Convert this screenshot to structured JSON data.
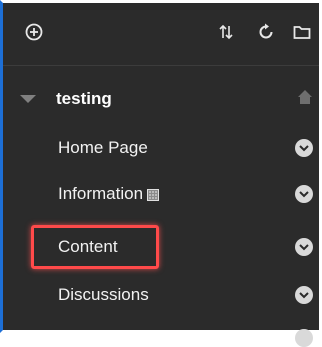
{
  "toolbar": {
    "icons": [
      "add-icon",
      "reorder-icon",
      "refresh-icon",
      "folder-icon"
    ]
  },
  "course": {
    "title": "testing",
    "home_icon": "home-icon"
  },
  "menu": {
    "items": [
      {
        "label": "Home Page"
      },
      {
        "label": "Information",
        "badge": "info-badge-icon"
      },
      {
        "label": "Content",
        "highlighted": true
      },
      {
        "label": "Discussions"
      }
    ]
  },
  "colors": {
    "panel_bg": "#2b2b2b",
    "accent_border": "#1d6fd6",
    "highlight": "#ff4a4a",
    "chevron_bg": "#d9d9d9"
  }
}
